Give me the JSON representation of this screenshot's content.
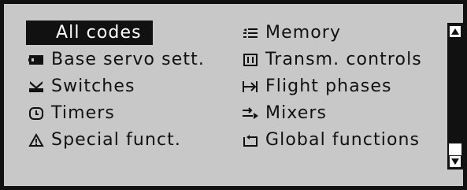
{
  "menu": {
    "left": [
      {
        "label": "All codes",
        "icon": "none",
        "selected": true
      },
      {
        "label": "Base servo sett.",
        "icon": "servo-block-icon",
        "selected": false
      },
      {
        "label": "Switches",
        "icon": "switch-lever-icon",
        "selected": false
      },
      {
        "label": "Timers",
        "icon": "timer-icon",
        "selected": false
      },
      {
        "label": "Special funct.",
        "icon": "warning-triangle-icon",
        "selected": false
      }
    ],
    "right": [
      {
        "label": "Memory",
        "icon": "memory-list-icon"
      },
      {
        "label": "Transm. controls",
        "icon": "transmitter-controls-icon"
      },
      {
        "label": "Flight phases",
        "icon": "flight-phase-arrow-icon"
      },
      {
        "label": "Mixers",
        "icon": "mixer-arrows-icon"
      },
      {
        "label": "Global functions",
        "icon": "global-functions-icon"
      }
    ]
  },
  "scrollbar": {
    "up_icon": "triangle-up-icon",
    "down_icon": "triangle-down-icon",
    "position": 0.9
  },
  "colors": {
    "background": "#c8c8c8",
    "foreground": "#111111",
    "selection_bg": "#111111",
    "selection_fg": "#ffffff"
  }
}
